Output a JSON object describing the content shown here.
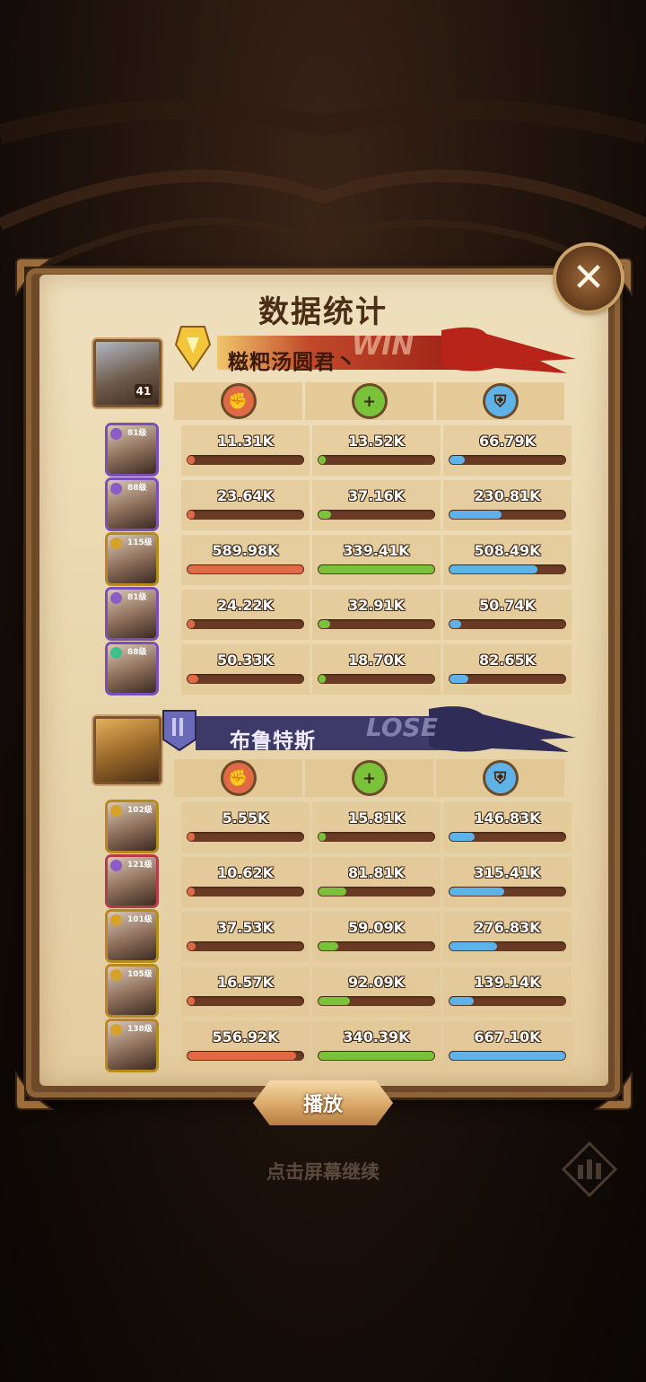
{
  "title": "数据统计",
  "close_label": "✕",
  "team1": {
    "name": "糍粑汤圆君丶",
    "result": "WIN",
    "avatar_level": "41",
    "rows": [
      {
        "level": "81级",
        "elem": "#8b5cc8",
        "frame": "#7a4fb8",
        "damage": "11.31K",
        "heal": "13.52K",
        "tank": "66.79K",
        "d": 0.02,
        "h": 0.04,
        "t": 0.13
      },
      {
        "level": "88级",
        "elem": "#8b5cc8",
        "frame": "#7a4fb8",
        "damage": "23.64K",
        "heal": "37.16K",
        "tank": "230.81K",
        "d": 0.04,
        "h": 0.11,
        "t": 0.45
      },
      {
        "level": "115级",
        "elem": "#d7a22a",
        "frame": "#b8891f",
        "damage": "589.98K",
        "heal": "339.41K",
        "tank": "508.49K",
        "d": 1.0,
        "h": 1.0,
        "t": 0.76
      },
      {
        "level": "81级",
        "elem": "#8b5cc8",
        "frame": "#7a4fb8",
        "damage": "24.22K",
        "heal": "32.91K",
        "tank": "50.74K",
        "d": 0.04,
        "h": 0.1,
        "t": 0.1
      },
      {
        "level": "88级",
        "elem": "#3fbf8a",
        "frame": "#7a4fb8",
        "damage": "50.33K",
        "heal": "18.70K",
        "tank": "82.65K",
        "d": 0.09,
        "h": 0.06,
        "t": 0.16
      }
    ]
  },
  "team2": {
    "name": "布鲁特斯",
    "result": "LOSE",
    "rows": [
      {
        "level": "102级",
        "elem": "#d7a22a",
        "frame": "#b8891f",
        "damage": "5.55K",
        "heal": "15.81K",
        "tank": "146.83K",
        "d": 0.01,
        "h": 0.05,
        "t": 0.22
      },
      {
        "level": "121级",
        "elem": "#8b5cc8",
        "frame": "#b83a4a",
        "damage": "10.62K",
        "heal": "81.81K",
        "tank": "315.41K",
        "d": 0.02,
        "h": 0.24,
        "t": 0.47
      },
      {
        "level": "101级",
        "elem": "#d7a22a",
        "frame": "#b8891f",
        "damage": "37.53K",
        "heal": "59.09K",
        "tank": "276.83K",
        "d": 0.07,
        "h": 0.17,
        "t": 0.41
      },
      {
        "level": "105级",
        "elem": "#d7a22a",
        "frame": "#b8891f",
        "damage": "16.57K",
        "heal": "92.09K",
        "tank": "139.14K",
        "d": 0.03,
        "h": 0.27,
        "t": 0.21
      },
      {
        "level": "138级",
        "elem": "#d7a22a",
        "frame": "#b8891f",
        "damage": "556.92K",
        "heal": "340.39K",
        "tank": "667.10K",
        "d": 0.94,
        "h": 1.0,
        "t": 1.0
      }
    ]
  },
  "columns": [
    {
      "icon": "damage-fist-icon",
      "color": "#e06a45"
    },
    {
      "icon": "heal-plus-icon",
      "color": "#7ac23a"
    },
    {
      "icon": "shield-icon",
      "color": "#5fb2e8"
    }
  ],
  "play_label": "播放",
  "hint": "点击屏幕继续"
}
